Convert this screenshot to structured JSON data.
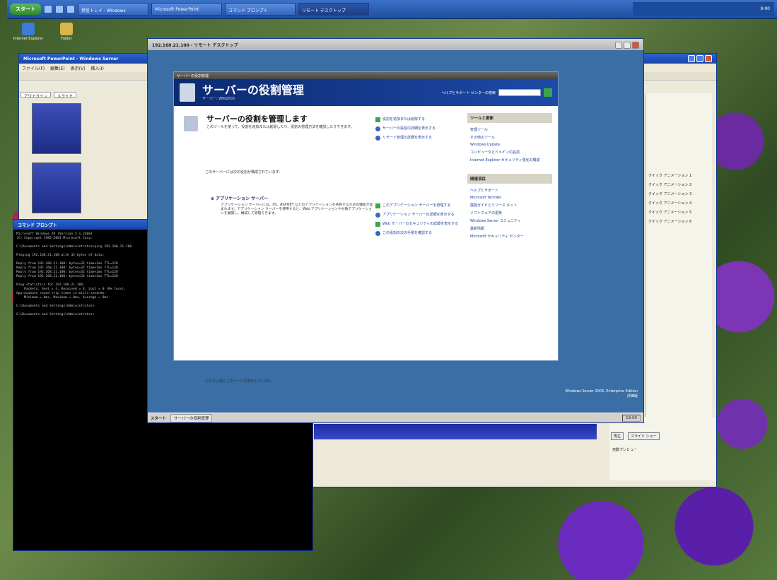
{
  "taskbar": {
    "start_label": "スタート",
    "buttons": [
      {
        "label": "受信トレイ - Windows"
      },
      {
        "label": "Microsoft PowerPoint"
      },
      {
        "label": "コマンド プロンプト"
      },
      {
        "label": "リモート デスクトップ"
      }
    ],
    "tray_text": "9:00"
  },
  "desktop_icons": [
    {
      "label": "Internet Explorer"
    },
    {
      "label": "Folder"
    }
  ],
  "ppt": {
    "title": "Microsoft PowerPoint - Windows Server",
    "menu": [
      "ファイル(F)",
      "編集(E)",
      "表示(V)",
      "挿入(I)"
    ],
    "tabs": [
      "アウトライン",
      "スライド"
    ],
    "taskpane": {
      "items": [
        "クイック アニメーション 1",
        "クイック アニメーション 2",
        "クイック アニメーション 3",
        "クイック アニメーション 4",
        "クイック アニメーション 5",
        "クイック アニメーション 6"
      ],
      "play_label": "再生",
      "show_label": "スライド ショー",
      "auto_preview": "自動プレビュー"
    }
  },
  "console": {
    "title": "コマンド プロンプト",
    "lines": [
      "Microsoft Windows XP [Version 5.1.2600]",
      "(C) Copyright 1985-2001 Microsoft Corp.",
      "",
      "C:\\Documents and Settings\\Administrator>ping 192.168.21.100",
      "",
      "Pinging 192.168.21.100 with 32 bytes of data:",
      "",
      "Reply from 192.168.21.100: bytes=32 time<1ms TTL=128",
      "Reply from 192.168.21.100: bytes=32 time<1ms TTL=128",
      "Reply from 192.168.21.100: bytes=32 time<1ms TTL=128",
      "Reply from 192.168.21.100: bytes=32 time<1ms TTL=128",
      "",
      "Ping statistics for 192.168.21.100:",
      "    Packets: Sent = 4, Received = 4, Lost = 0 (0% loss),",
      "Approximate round trip times in milli-seconds:",
      "    Minimum = 0ms, Maximum = 0ms, Average = 0ms",
      "",
      "C:\\Documents and Settings\\Administrator>",
      "",
      "C:\\Documents and Settings\\Administrator>"
    ]
  },
  "rdp": {
    "title": "192.168.21.100 - リモート デスクトップ",
    "inner_title": "サーバーの役割管理",
    "banner": {
      "title": "サーバーの役割管理",
      "subtitle": "サーバー: WIN2003",
      "search_label": "ヘルプとサポート センターの検索",
      "search_value": ""
    },
    "heading": "サーバーの役割を管理します",
    "heading_desc": "このツールを使って、役割を追加または削除したり、役割の管理方法を確認したりできます。",
    "actions_top": [
      "役割を追加または削除する",
      "サーバーの役割の詳細を表示する",
      "リモート管理の詳細を表示する"
    ],
    "section_text": "このサーバーには次の役割が構成されています:",
    "role_title": "アプリケーション サーバー",
    "role_desc": "アプリケーション サーバーには、IIS、ASP.NET などのアプリケーションを共有するための機能が含まれます。アプリケーション サーバーを使用すると、Web アプリケーションや分散アプリケーションを展開し、構成して管理できます。",
    "actions_role": [
      "このアプリケーション サーバーを管理する",
      "アプリケーション サーバーの詳細を表示する",
      "Web サーバーのセキュリティの詳細を表示する",
      "この役割の次の手順を確認する"
    ],
    "footer": "ログオン時にこのページを表示しない(D)",
    "tools": {
      "header": "ツールと更新",
      "items": [
        "管理ツール",
        "その他のツール",
        "Windows Update",
        "コンピュータとドメインの名前",
        "Internet Explorer セキュリティ強化の構成"
      ]
    },
    "see_also": {
      "header": "関連項目",
      "items": [
        "ヘルプとサポート",
        "Microsoft TechNet",
        "展開ガイドとリソース キット",
        "ソフトウェアの更新",
        "Windows Server コミュニティ",
        "最新情報",
        "Microsoft セキュリティ センター"
      ]
    },
    "status_line1": "Windows Server 2003, Enterprise Edition",
    "status_line2": "評価版",
    "taskbar": {
      "start": "スタート",
      "item": "サーバーの役割管理",
      "clock": "19:00"
    }
  }
}
